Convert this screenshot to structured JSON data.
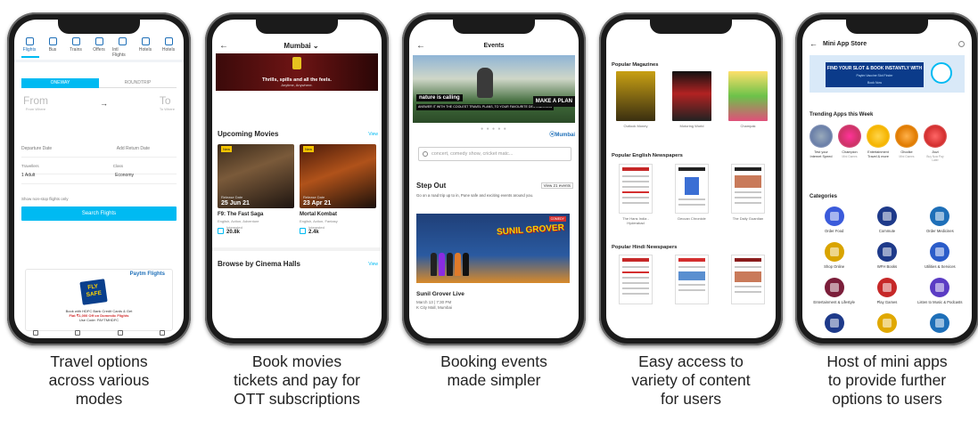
{
  "colors": {
    "accent": "#00baf2",
    "brand_blue": "#1e6fb8",
    "text": "#222222"
  },
  "phone1": {
    "tabs": [
      {
        "label": "Flights",
        "icon": "plane-icon"
      },
      {
        "label": "Bus",
        "icon": "bus-icon"
      },
      {
        "label": "Trains",
        "icon": "train-icon"
      },
      {
        "label": "Offers",
        "icon": "offers-icon"
      },
      {
        "label": "Intl Flights",
        "icon": "globe-icon"
      },
      {
        "label": "Hotels",
        "icon": "hotel-icon"
      },
      {
        "label": "Hotels",
        "icon": "hotel-icon"
      }
    ],
    "trip_oneway": "ONEWAY",
    "trip_roundtrip": "ROUNDTRIP",
    "from_label": "From",
    "from_sub": "From Where",
    "to_label": "To",
    "to_sub": "To Where",
    "departure_label": "Departure Date",
    "return_label": "Add Return Date",
    "travellers_label": "Travellers",
    "travellers_value": "1 Adult",
    "class_label": "Class",
    "class_value": "Economy",
    "nonstop_label": "Show non-stop flights only",
    "search_button": "Search Flights",
    "banner_brand": "Paytm Flights",
    "banner_badge": "FLY SAFE",
    "banner_line1": "Book with HDFC Bank Credit Cards & Get",
    "banner_offer": "Flat ₹1,000 Off on Domestic Flights",
    "banner_code": "Use Code: PAYTMHDFC"
  },
  "phone2": {
    "city": "Mumbai",
    "hero_title": "Thrills, spills and all the feels.",
    "hero_sub": "Anytime, Anywhere.",
    "upcoming_title": "Upcoming Movies",
    "upcoming_link": "View",
    "movies": [
      {
        "badge": "New",
        "release_label": "Release Date",
        "date": "25 Jun 21",
        "title": "F9: The Fast Saga",
        "genre": "English, Action, Adventure",
        "interested_label": "Interested",
        "interested": "20.8k"
      },
      {
        "badge": "New",
        "release_label": "Release Date",
        "date": "23 Apr 21",
        "title": "Mortal Kombat",
        "genre": "English, Action, Fantasy",
        "interested_label": "Interested",
        "interested": "2.4k"
      }
    ],
    "halls_title": "Browse by Cinema Halls",
    "halls_link": "View"
  },
  "phone3": {
    "title": "Events",
    "hero_tag": "nature is calling",
    "hero_sub": "ANSWER IT WITH THE COOLEST TRAVEL PLANS, TO YOUR FAVOURITE DESTINATIONS",
    "hero_cta": "MAKE A PLAN",
    "location": "Mumbai",
    "search_placeholder": "concert, comedy show, cricket matc...",
    "step_out_title": "Step Out",
    "view_all": "View 21 events",
    "step_out_desc": "Go on a road trip up to in, Pune safe and exciting events around you.",
    "event_badge": "COMEDY",
    "event_poster": "SUNIL GROVER",
    "event_title": "Sunil Grover Live",
    "event_date": "March 13 | 7:30 PM",
    "event_venue": "K City Mall, Mumbai"
  },
  "phone4": {
    "magazines_title": "Popular Magazines",
    "magazines": [
      "Outlook Money",
      "Motoring World",
      "Champak"
    ],
    "english_title": "Popular English Newspapers",
    "english": [
      "The Hans India - Hyderabad",
      "Deccan Chronicle",
      "The Daily Guardian"
    ],
    "hindi_title": "Popular Hindi Newspapers",
    "hindi": [
      "",
      "",
      ""
    ]
  },
  "phone5": {
    "title": "Mini App Store",
    "banner_title": "FIND YOUR SLOT & BOOK INSTANTLY WITH",
    "banner_sub": "Paytm Vaccine Slot Finder",
    "banner_cta": "Book Now",
    "trending_title": "Trending Apps this Week",
    "trending": [
      {
        "name": "Test your Internet Speed",
        "kind": ""
      },
      {
        "name": "Champion",
        "kind": "Mini Games"
      },
      {
        "name": "Entertainment Travel & more",
        "kind": ""
      },
      {
        "name": "Ghodke",
        "kind": "Mini Games"
      },
      {
        "name": "Jiozi",
        "kind": "Buy Now Pay Later"
      }
    ],
    "categories_title": "Categories",
    "categories": [
      {
        "name": "Order Food",
        "color": "#3b5bdb"
      },
      {
        "name": "Commute",
        "color": "#1e3a8a"
      },
      {
        "name": "Order Medicines",
        "color": "#1e6fb8"
      },
      {
        "name": "Shop Online",
        "color": "#d9a400"
      },
      {
        "name": "WFH Books",
        "color": "#1e3a8a"
      },
      {
        "name": "Utilities & Services",
        "color": "#2b5cc9"
      },
      {
        "name": "Entertainment & Lifestyle",
        "color": "#7b1e3a"
      },
      {
        "name": "Play Games",
        "color": "#c62828"
      },
      {
        "name": "Listen to Music & Podcasts",
        "color": "#5b3cc4"
      },
      {
        "name": "",
        "color": "#1e3a8a"
      },
      {
        "name": "",
        "color": "#e0a800"
      },
      {
        "name": "",
        "color": "#1e6fb8"
      }
    ]
  },
  "captions": [
    {
      "line1": "Travel options",
      "line2": "across various",
      "line3": "modes"
    },
    {
      "line1": "Book movies",
      "line2": "tickets and pay for",
      "line3": "OTT subscriptions"
    },
    {
      "line1": "Booking events",
      "line2": "made simpler",
      "line3": ""
    },
    {
      "line1": "Easy access to",
      "line2": "variety of content",
      "line3": "for users"
    },
    {
      "line1": "Host of mini apps",
      "line2": "to provide further",
      "line3": "options to users"
    }
  ]
}
